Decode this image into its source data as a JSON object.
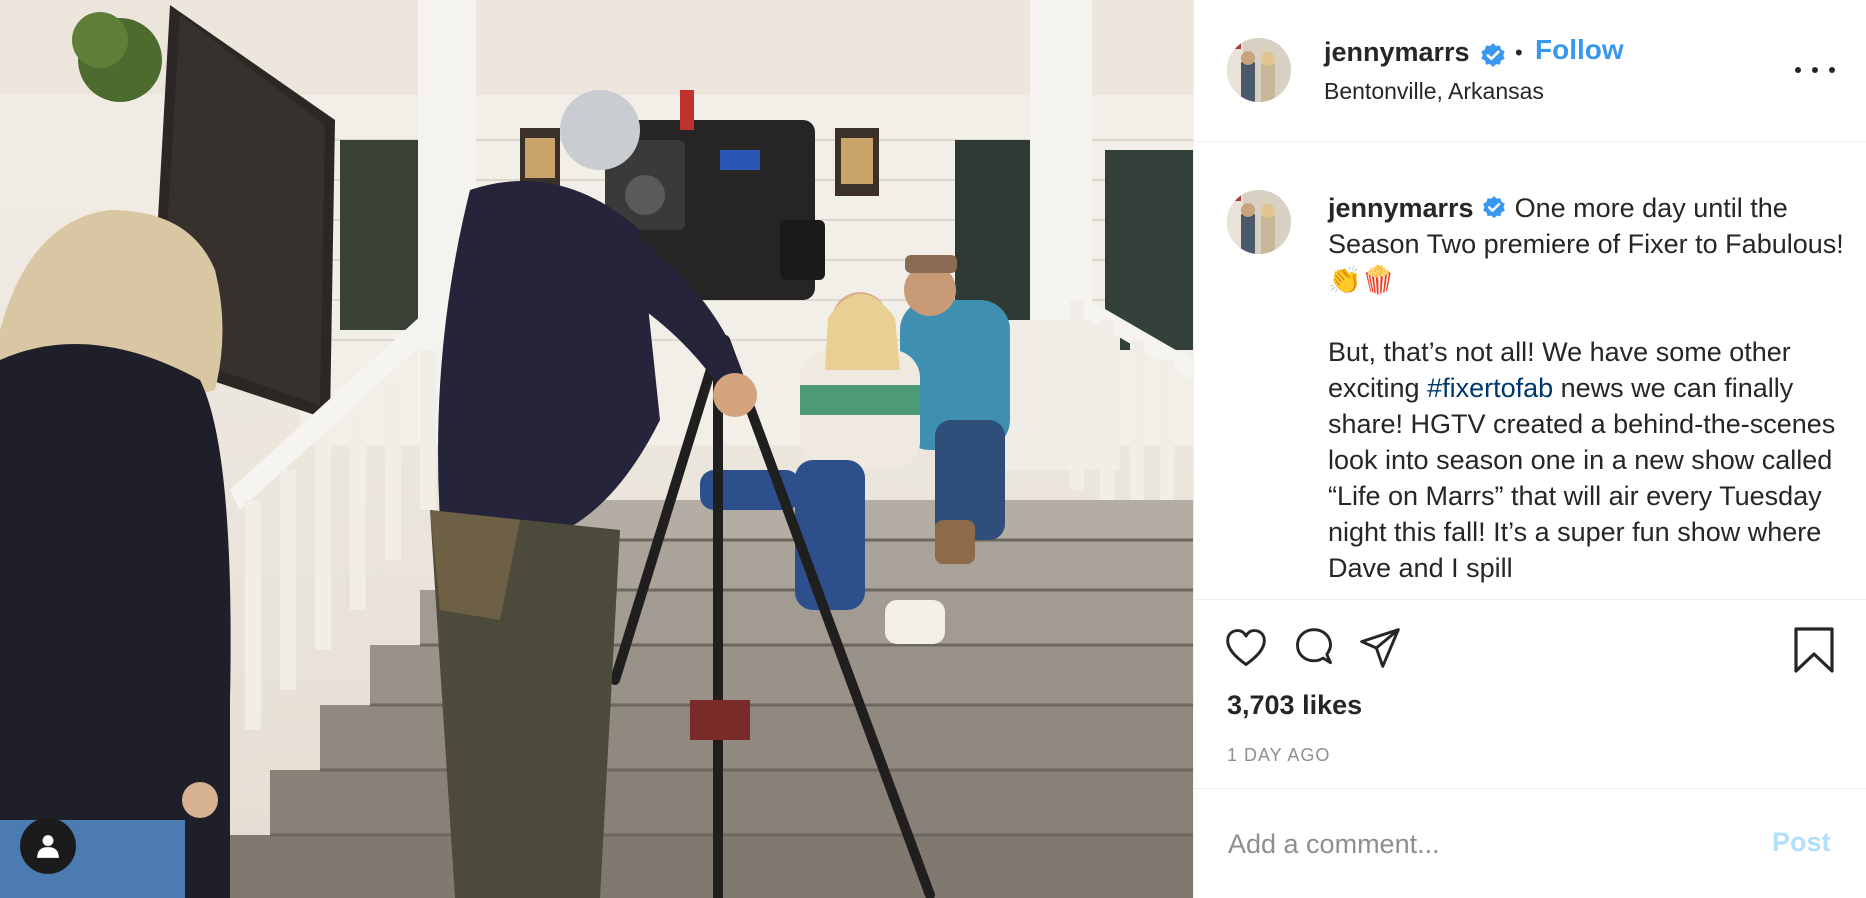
{
  "header": {
    "username": "jennymarrs",
    "separator": "•",
    "follow_label": "Follow",
    "location": "Bentonville, Arkansas",
    "more_icon": "more-horizontal-icon"
  },
  "caption": {
    "username": "jennymarrs",
    "line1": "One more day until the Season Two premiere of Fixer to Fabulous! 👏🍿",
    "line2_before": "But, that’s not all! We have some other exciting ",
    "hashtag": "#fixertofab",
    "line2_after": " news we can finally share! HGTV created a behind-the-scenes look into season one in a new show called “Life on Marrs” that will air every Tuesday night this fall! It’s a super fun show where Dave and I spill"
  },
  "actions": {
    "like_icon": "heart-icon",
    "comment_icon": "comment-bubble-icon",
    "share_icon": "paper-plane-icon",
    "save_icon": "bookmark-icon"
  },
  "likes_text": "3,703 likes",
  "timestamp": "1 DAY AGO",
  "comment": {
    "placeholder": "Add a comment...",
    "value": "",
    "post_label": "Post"
  },
  "colors": {
    "accent": "#3897f0",
    "verified": "#3897f0",
    "hashtag": "#00376b",
    "muted": "#8e8e8e",
    "post_disabled": "#b2dffc"
  }
}
